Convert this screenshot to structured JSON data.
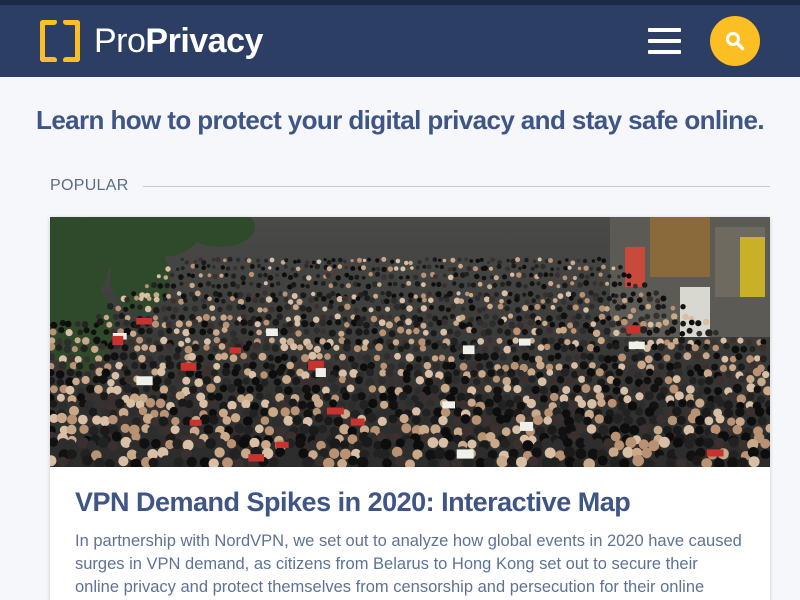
{
  "brand": {
    "name_part1": "Pro",
    "name_part2": "Privacy",
    "accent_color": "#fbbf24",
    "header_color": "#2c3e64"
  },
  "header": {
    "menu_icon": "hamburger-menu-icon",
    "search_icon": "search-icon"
  },
  "tagline": "Learn how to protect your digital privacy and stay safe online.",
  "section": {
    "label": "POPULAR"
  },
  "featured_article": {
    "image_description_icon": "protest-crowd-photo",
    "title": "VPN Demand Spikes in 2020: Interactive Map",
    "excerpt": "In partnership with NordVPN, we set out to analyze how global events in 2020 have caused surges in VPN demand, as citizens from Belarus to Hong Kong set out to secure their online privacy and protect themselves from censorship and persecution for their online activities"
  }
}
